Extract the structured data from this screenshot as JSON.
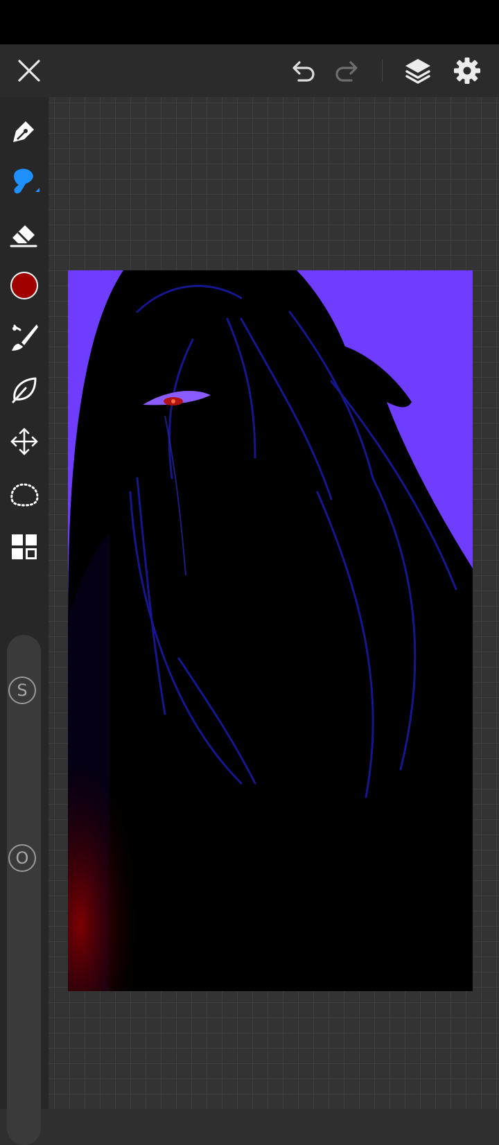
{
  "app": {
    "accent_color": "#1e90ff",
    "canvas_background": "#6f3dff"
  },
  "topbar": {
    "close_icon": "close-icon",
    "undo_icon": "undo-icon",
    "redo_icon": "redo-icon",
    "layers_icon": "layers-icon",
    "settings_icon": "gear-icon"
  },
  "toolbar": {
    "tools": [
      {
        "name": "pen-tool",
        "icon": "pen-nib-icon"
      },
      {
        "name": "brush-tool",
        "icon": "brush-icon",
        "selected": true
      },
      {
        "name": "eraser-tool",
        "icon": "eraser-icon"
      },
      {
        "name": "color-picker",
        "icon": "color-swatch",
        "color": "#a00000"
      },
      {
        "name": "paint-brush-tool",
        "icon": "paint-brush-icon"
      },
      {
        "name": "smudge-tool",
        "icon": "leaf-icon"
      },
      {
        "name": "transform-tool",
        "icon": "move-arrows-icon"
      },
      {
        "name": "lasso-tool",
        "icon": "lasso-icon"
      },
      {
        "name": "gallery-tool",
        "icon": "grid-icon"
      }
    ]
  },
  "sliders": {
    "size_label": "S",
    "opacity_label": "O"
  }
}
